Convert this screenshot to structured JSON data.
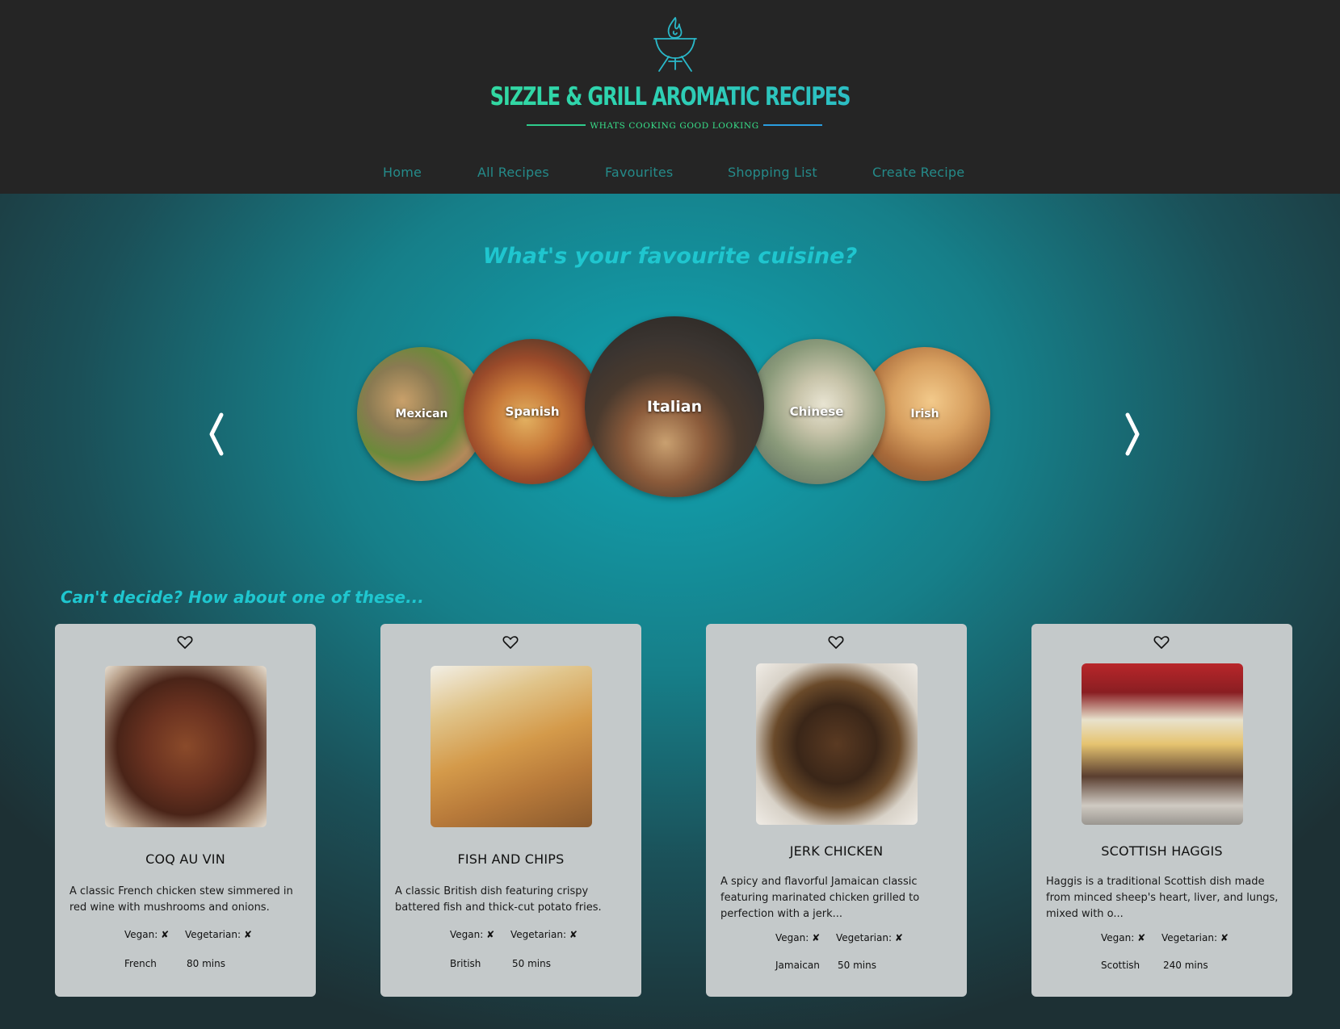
{
  "header": {
    "logo_icon": "grill-flame-icon",
    "title": "SIZZLE & GRILL AROMATIC RECIPES",
    "subtitle": "WHATS COOKING GOOD LOOKING"
  },
  "nav": {
    "items": [
      {
        "label": "Home"
      },
      {
        "label": "All Recipes"
      },
      {
        "label": "Favourites"
      },
      {
        "label": "Shopping List"
      },
      {
        "label": "Create Recipe"
      }
    ]
  },
  "cuisine_section": {
    "heading": "What's your favourite cuisine?",
    "prev_icon": "chevron-left-icon",
    "next_icon": "chevron-right-icon",
    "cuisines": [
      {
        "label": "Mexican"
      },
      {
        "label": "Spanish"
      },
      {
        "label": "Italian"
      },
      {
        "label": "Chinese"
      },
      {
        "label": "Irish"
      }
    ]
  },
  "suggestions": {
    "heading": "Can't decide? How about one of these...",
    "cards": [
      {
        "title": "COQ AU VIN",
        "description": "A classic French chicken stew simmered in red wine with mushrooms and onions.",
        "vegan_label": "Vegan:",
        "vegan_value": "✘",
        "vegetarian_label": "Vegetarian:",
        "vegetarian_value": "✘",
        "cuisine": "French",
        "time": "80 mins"
      },
      {
        "title": "FISH AND CHIPS",
        "description": "A classic British dish featuring crispy battered fish and thick-cut potato fries.",
        "vegan_label": "Vegan:",
        "vegan_value": "✘",
        "vegetarian_label": "Vegetarian:",
        "vegetarian_value": "✘",
        "cuisine": "British",
        "time": "50 mins"
      },
      {
        "title": "JERK CHICKEN",
        "description": "A spicy and flavorful Jamaican classic featuring marinated chicken grilled to perfection with a jerk...",
        "vegan_label": "Vegan:",
        "vegan_value": "✘",
        "vegetarian_label": "Vegetarian:",
        "vegetarian_value": "✘",
        "cuisine": "Jamaican",
        "time": "50 mins"
      },
      {
        "title": "SCOTTISH HAGGIS",
        "description": "Haggis is a traditional Scottish dish made from minced sheep's heart, liver, and lungs, mixed with o...",
        "vegan_label": "Vegan:",
        "vegan_value": "✘",
        "vegetarian_label": "Vegetarian:",
        "vegetarian_value": "✘",
        "cuisine": "Scottish",
        "time": "240 mins"
      }
    ]
  }
}
